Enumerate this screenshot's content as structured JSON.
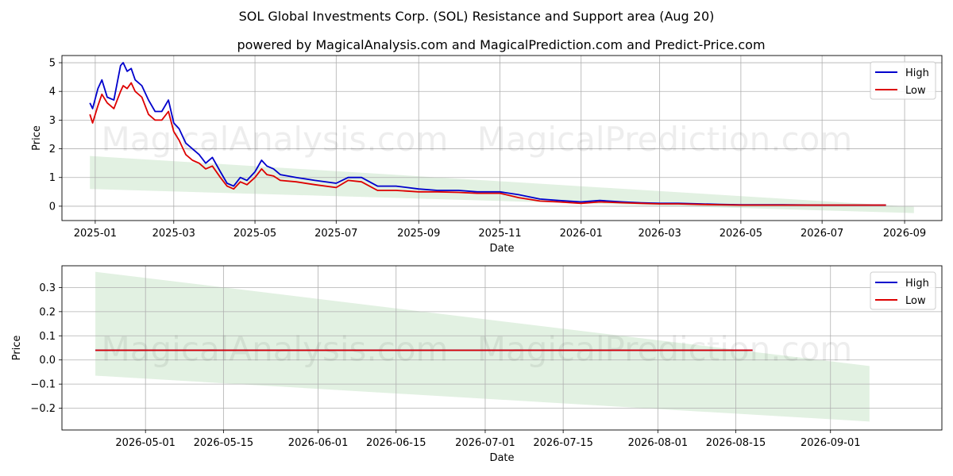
{
  "title": "SOL Global Investments Corp. (SOL) Resistance and Support area (Aug 20)",
  "subtitle": "powered by MagicalAnalysis.com and MagicalPrediction.com and Predict-Price.com",
  "watermarks": [
    "MagicalAnalysis.com",
    "MagicalPrediction.com"
  ],
  "colors": {
    "high": "#0000cc",
    "low": "#dd0000",
    "band": "#cfe8cf",
    "grid": "#b0b0b0"
  },
  "chart_data": [
    {
      "type": "line",
      "xlabel": "Date",
      "ylabel": "Price",
      "x_ticks": [
        "2025-01",
        "2025-03",
        "2025-05",
        "2025-07",
        "2025-09",
        "2025-11",
        "2026-01",
        "2026-03",
        "2026-05",
        "2026-07",
        "2026-09"
      ],
      "y_ticks": [
        "0",
        "1",
        "2",
        "3",
        "4",
        "5"
      ],
      "xlim": [
        "2024-12-07",
        "2026-09-29"
      ],
      "ylim": [
        -0.5,
        5.25
      ],
      "grid": true,
      "legend": "top-right",
      "legend_entries": [
        "High",
        "Low"
      ],
      "series": [
        {
          "name": "High",
          "x": [
            "2024-12-28",
            "2024-12-30",
            "2025-01-03",
            "2025-01-06",
            "2025-01-10",
            "2025-01-15",
            "2025-01-20",
            "2025-01-22",
            "2025-01-25",
            "2025-01-28",
            "2025-01-31",
            "2025-02-05",
            "2025-02-10",
            "2025-02-15",
            "2025-02-20",
            "2025-02-25",
            "2025-03-01",
            "2025-03-05",
            "2025-03-10",
            "2025-03-15",
            "2025-03-20",
            "2025-03-25",
            "2025-03-30",
            "2025-04-05",
            "2025-04-10",
            "2025-04-15",
            "2025-04-20",
            "2025-04-25",
            "2025-05-01",
            "2025-05-06",
            "2025-05-10",
            "2025-05-15",
            "2025-05-20",
            "2025-06-01",
            "2025-06-15",
            "2025-07-01",
            "2025-07-10",
            "2025-07-20",
            "2025-08-01",
            "2025-08-15",
            "2025-09-01",
            "2025-09-15",
            "2025-10-01",
            "2025-10-15",
            "2025-11-01",
            "2025-11-15",
            "2025-12-01",
            "2025-12-15",
            "2026-01-01",
            "2026-01-15",
            "2026-02-01",
            "2026-02-15",
            "2026-03-01",
            "2026-03-15",
            "2026-04-01",
            "2026-04-15",
            "2026-05-01",
            "2026-06-01",
            "2026-07-01",
            "2026-08-01",
            "2026-08-18"
          ],
          "values": [
            3.6,
            3.4,
            4.1,
            4.4,
            3.8,
            3.7,
            4.9,
            5.0,
            4.7,
            4.8,
            4.4,
            4.2,
            3.7,
            3.3,
            3.3,
            3.7,
            2.9,
            2.7,
            2.2,
            2.0,
            1.8,
            1.5,
            1.7,
            1.2,
            0.8,
            0.7,
            1.0,
            0.9,
            1.2,
            1.6,
            1.4,
            1.3,
            1.1,
            1.0,
            0.9,
            0.8,
            1.0,
            1.0,
            0.7,
            0.7,
            0.6,
            0.55,
            0.55,
            0.5,
            0.5,
            0.4,
            0.25,
            0.2,
            0.15,
            0.2,
            0.15,
            0.12,
            0.1,
            0.1,
            0.08,
            0.06,
            0.05,
            0.05,
            0.04,
            0.04,
            0.04
          ]
        },
        {
          "name": "Low",
          "x": [
            "2024-12-28",
            "2024-12-30",
            "2025-01-03",
            "2025-01-06",
            "2025-01-10",
            "2025-01-15",
            "2025-01-20",
            "2025-01-22",
            "2025-01-25",
            "2025-01-28",
            "2025-01-31",
            "2025-02-05",
            "2025-02-10",
            "2025-02-15",
            "2025-02-20",
            "2025-02-25",
            "2025-03-01",
            "2025-03-05",
            "2025-03-10",
            "2025-03-15",
            "2025-03-20",
            "2025-03-25",
            "2025-03-30",
            "2025-04-05",
            "2025-04-10",
            "2025-04-15",
            "2025-04-20",
            "2025-04-25",
            "2025-05-01",
            "2025-05-06",
            "2025-05-10",
            "2025-05-15",
            "2025-05-20",
            "2025-06-01",
            "2025-06-15",
            "2025-07-01",
            "2025-07-10",
            "2025-07-20",
            "2025-08-01",
            "2025-08-15",
            "2025-09-01",
            "2025-09-15",
            "2025-10-01",
            "2025-10-15",
            "2025-11-01",
            "2025-11-15",
            "2025-12-01",
            "2025-12-15",
            "2026-01-01",
            "2026-01-15",
            "2026-02-01",
            "2026-02-15",
            "2026-03-01",
            "2026-03-15",
            "2026-04-01",
            "2026-04-15",
            "2026-05-01",
            "2026-06-01",
            "2026-07-01",
            "2026-08-01",
            "2026-08-18"
          ],
          "values": [
            3.2,
            2.9,
            3.5,
            3.9,
            3.6,
            3.4,
            4.0,
            4.2,
            4.1,
            4.3,
            4.0,
            3.8,
            3.2,
            3.0,
            3.0,
            3.3,
            2.6,
            2.3,
            1.8,
            1.6,
            1.5,
            1.3,
            1.4,
            1.0,
            0.7,
            0.6,
            0.85,
            0.75,
            1.0,
            1.3,
            1.1,
            1.05,
            0.9,
            0.85,
            0.75,
            0.65,
            0.9,
            0.85,
            0.55,
            0.55,
            0.5,
            0.5,
            0.48,
            0.45,
            0.45,
            0.3,
            0.18,
            0.15,
            0.1,
            0.15,
            0.12,
            0.1,
            0.08,
            0.08,
            0.06,
            0.05,
            0.04,
            0.04,
            0.04,
            0.04,
            0.04
          ]
        }
      ],
      "band": {
        "x": [
          "2024-12-28",
          "2026-09-08"
        ],
        "upper": [
          1.75,
          -0.02
        ],
        "lower": [
          0.6,
          -0.24
        ]
      }
    },
    {
      "type": "line",
      "xlabel": "Date",
      "ylabel": "Price",
      "x_ticks": [
        "2026-05-01",
        "2026-05-15",
        "2026-06-01",
        "2026-06-15",
        "2026-07-01",
        "2026-07-15",
        "2026-08-01",
        "2026-08-15",
        "2026-09-01"
      ],
      "y_ticks": [
        "0.3",
        "0.2",
        "0.1",
        "0.0",
        "−0.1",
        "−0.2"
      ],
      "xlim": [
        "2026-04-16",
        "2026-09-21"
      ],
      "ylim": [
        -0.29,
        0.39
      ],
      "grid": true,
      "legend": "top-right",
      "legend_entries": [
        "High",
        "Low"
      ],
      "series": [
        {
          "name": "High",
          "x": [
            "2026-04-22",
            "2026-08-18"
          ],
          "values": [
            0.04,
            0.04
          ]
        },
        {
          "name": "Low",
          "x": [
            "2026-04-22",
            "2026-08-18"
          ],
          "values": [
            0.04,
            0.04
          ]
        }
      ],
      "band": {
        "x": [
          "2026-04-22",
          "2026-09-08"
        ],
        "upper": [
          0.365,
          -0.025
        ],
        "lower": [
          -0.065,
          -0.255
        ]
      }
    }
  ]
}
